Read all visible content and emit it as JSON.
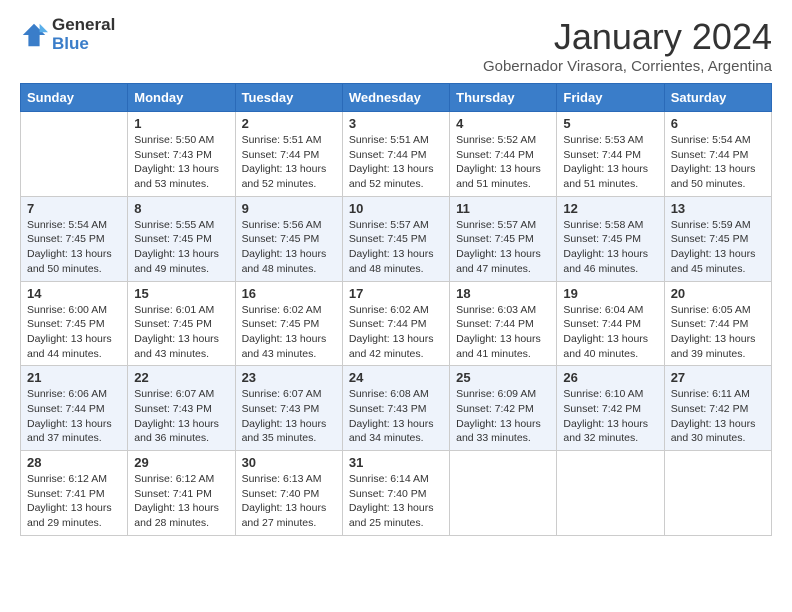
{
  "logo": {
    "line1": "General",
    "line2": "Blue"
  },
  "title": "January 2024",
  "subtitle": "Gobernador Virasora, Corrientes, Argentina",
  "days": [
    "Sunday",
    "Monday",
    "Tuesday",
    "Wednesday",
    "Thursday",
    "Friday",
    "Saturday"
  ],
  "weeks": [
    [
      {
        "day": "",
        "sunrise": "",
        "sunset": "",
        "daylight": ""
      },
      {
        "day": "1",
        "sunrise": "Sunrise: 5:50 AM",
        "sunset": "Sunset: 7:43 PM",
        "daylight": "Daylight: 13 hours and 53 minutes."
      },
      {
        "day": "2",
        "sunrise": "Sunrise: 5:51 AM",
        "sunset": "Sunset: 7:44 PM",
        "daylight": "Daylight: 13 hours and 52 minutes."
      },
      {
        "day": "3",
        "sunrise": "Sunrise: 5:51 AM",
        "sunset": "Sunset: 7:44 PM",
        "daylight": "Daylight: 13 hours and 52 minutes."
      },
      {
        "day": "4",
        "sunrise": "Sunrise: 5:52 AM",
        "sunset": "Sunset: 7:44 PM",
        "daylight": "Daylight: 13 hours and 51 minutes."
      },
      {
        "day": "5",
        "sunrise": "Sunrise: 5:53 AM",
        "sunset": "Sunset: 7:44 PM",
        "daylight": "Daylight: 13 hours and 51 minutes."
      },
      {
        "day": "6",
        "sunrise": "Sunrise: 5:54 AM",
        "sunset": "Sunset: 7:44 PM",
        "daylight": "Daylight: 13 hours and 50 minutes."
      }
    ],
    [
      {
        "day": "7",
        "sunrise": "Sunrise: 5:54 AM",
        "sunset": "Sunset: 7:45 PM",
        "daylight": "Daylight: 13 hours and 50 minutes."
      },
      {
        "day": "8",
        "sunrise": "Sunrise: 5:55 AM",
        "sunset": "Sunset: 7:45 PM",
        "daylight": "Daylight: 13 hours and 49 minutes."
      },
      {
        "day": "9",
        "sunrise": "Sunrise: 5:56 AM",
        "sunset": "Sunset: 7:45 PM",
        "daylight": "Daylight: 13 hours and 48 minutes."
      },
      {
        "day": "10",
        "sunrise": "Sunrise: 5:57 AM",
        "sunset": "Sunset: 7:45 PM",
        "daylight": "Daylight: 13 hours and 48 minutes."
      },
      {
        "day": "11",
        "sunrise": "Sunrise: 5:57 AM",
        "sunset": "Sunset: 7:45 PM",
        "daylight": "Daylight: 13 hours and 47 minutes."
      },
      {
        "day": "12",
        "sunrise": "Sunrise: 5:58 AM",
        "sunset": "Sunset: 7:45 PM",
        "daylight": "Daylight: 13 hours and 46 minutes."
      },
      {
        "day": "13",
        "sunrise": "Sunrise: 5:59 AM",
        "sunset": "Sunset: 7:45 PM",
        "daylight": "Daylight: 13 hours and 45 minutes."
      }
    ],
    [
      {
        "day": "14",
        "sunrise": "Sunrise: 6:00 AM",
        "sunset": "Sunset: 7:45 PM",
        "daylight": "Daylight: 13 hours and 44 minutes."
      },
      {
        "day": "15",
        "sunrise": "Sunrise: 6:01 AM",
        "sunset": "Sunset: 7:45 PM",
        "daylight": "Daylight: 13 hours and 43 minutes."
      },
      {
        "day": "16",
        "sunrise": "Sunrise: 6:02 AM",
        "sunset": "Sunset: 7:45 PM",
        "daylight": "Daylight: 13 hours and 43 minutes."
      },
      {
        "day": "17",
        "sunrise": "Sunrise: 6:02 AM",
        "sunset": "Sunset: 7:44 PM",
        "daylight": "Daylight: 13 hours and 42 minutes."
      },
      {
        "day": "18",
        "sunrise": "Sunrise: 6:03 AM",
        "sunset": "Sunset: 7:44 PM",
        "daylight": "Daylight: 13 hours and 41 minutes."
      },
      {
        "day": "19",
        "sunrise": "Sunrise: 6:04 AM",
        "sunset": "Sunset: 7:44 PM",
        "daylight": "Daylight: 13 hours and 40 minutes."
      },
      {
        "day": "20",
        "sunrise": "Sunrise: 6:05 AM",
        "sunset": "Sunset: 7:44 PM",
        "daylight": "Daylight: 13 hours and 39 minutes."
      }
    ],
    [
      {
        "day": "21",
        "sunrise": "Sunrise: 6:06 AM",
        "sunset": "Sunset: 7:44 PM",
        "daylight": "Daylight: 13 hours and 37 minutes."
      },
      {
        "day": "22",
        "sunrise": "Sunrise: 6:07 AM",
        "sunset": "Sunset: 7:43 PM",
        "daylight": "Daylight: 13 hours and 36 minutes."
      },
      {
        "day": "23",
        "sunrise": "Sunrise: 6:07 AM",
        "sunset": "Sunset: 7:43 PM",
        "daylight": "Daylight: 13 hours and 35 minutes."
      },
      {
        "day": "24",
        "sunrise": "Sunrise: 6:08 AM",
        "sunset": "Sunset: 7:43 PM",
        "daylight": "Daylight: 13 hours and 34 minutes."
      },
      {
        "day": "25",
        "sunrise": "Sunrise: 6:09 AM",
        "sunset": "Sunset: 7:42 PM",
        "daylight": "Daylight: 13 hours and 33 minutes."
      },
      {
        "day": "26",
        "sunrise": "Sunrise: 6:10 AM",
        "sunset": "Sunset: 7:42 PM",
        "daylight": "Daylight: 13 hours and 32 minutes."
      },
      {
        "day": "27",
        "sunrise": "Sunrise: 6:11 AM",
        "sunset": "Sunset: 7:42 PM",
        "daylight": "Daylight: 13 hours and 30 minutes."
      }
    ],
    [
      {
        "day": "28",
        "sunrise": "Sunrise: 6:12 AM",
        "sunset": "Sunset: 7:41 PM",
        "daylight": "Daylight: 13 hours and 29 minutes."
      },
      {
        "day": "29",
        "sunrise": "Sunrise: 6:12 AM",
        "sunset": "Sunset: 7:41 PM",
        "daylight": "Daylight: 13 hours and 28 minutes."
      },
      {
        "day": "30",
        "sunrise": "Sunrise: 6:13 AM",
        "sunset": "Sunset: 7:40 PM",
        "daylight": "Daylight: 13 hours and 27 minutes."
      },
      {
        "day": "31",
        "sunrise": "Sunrise: 6:14 AM",
        "sunset": "Sunset: 7:40 PM",
        "daylight": "Daylight: 13 hours and 25 minutes."
      },
      {
        "day": "",
        "sunrise": "",
        "sunset": "",
        "daylight": ""
      },
      {
        "day": "",
        "sunrise": "",
        "sunset": "",
        "daylight": ""
      },
      {
        "day": "",
        "sunrise": "",
        "sunset": "",
        "daylight": ""
      }
    ]
  ]
}
